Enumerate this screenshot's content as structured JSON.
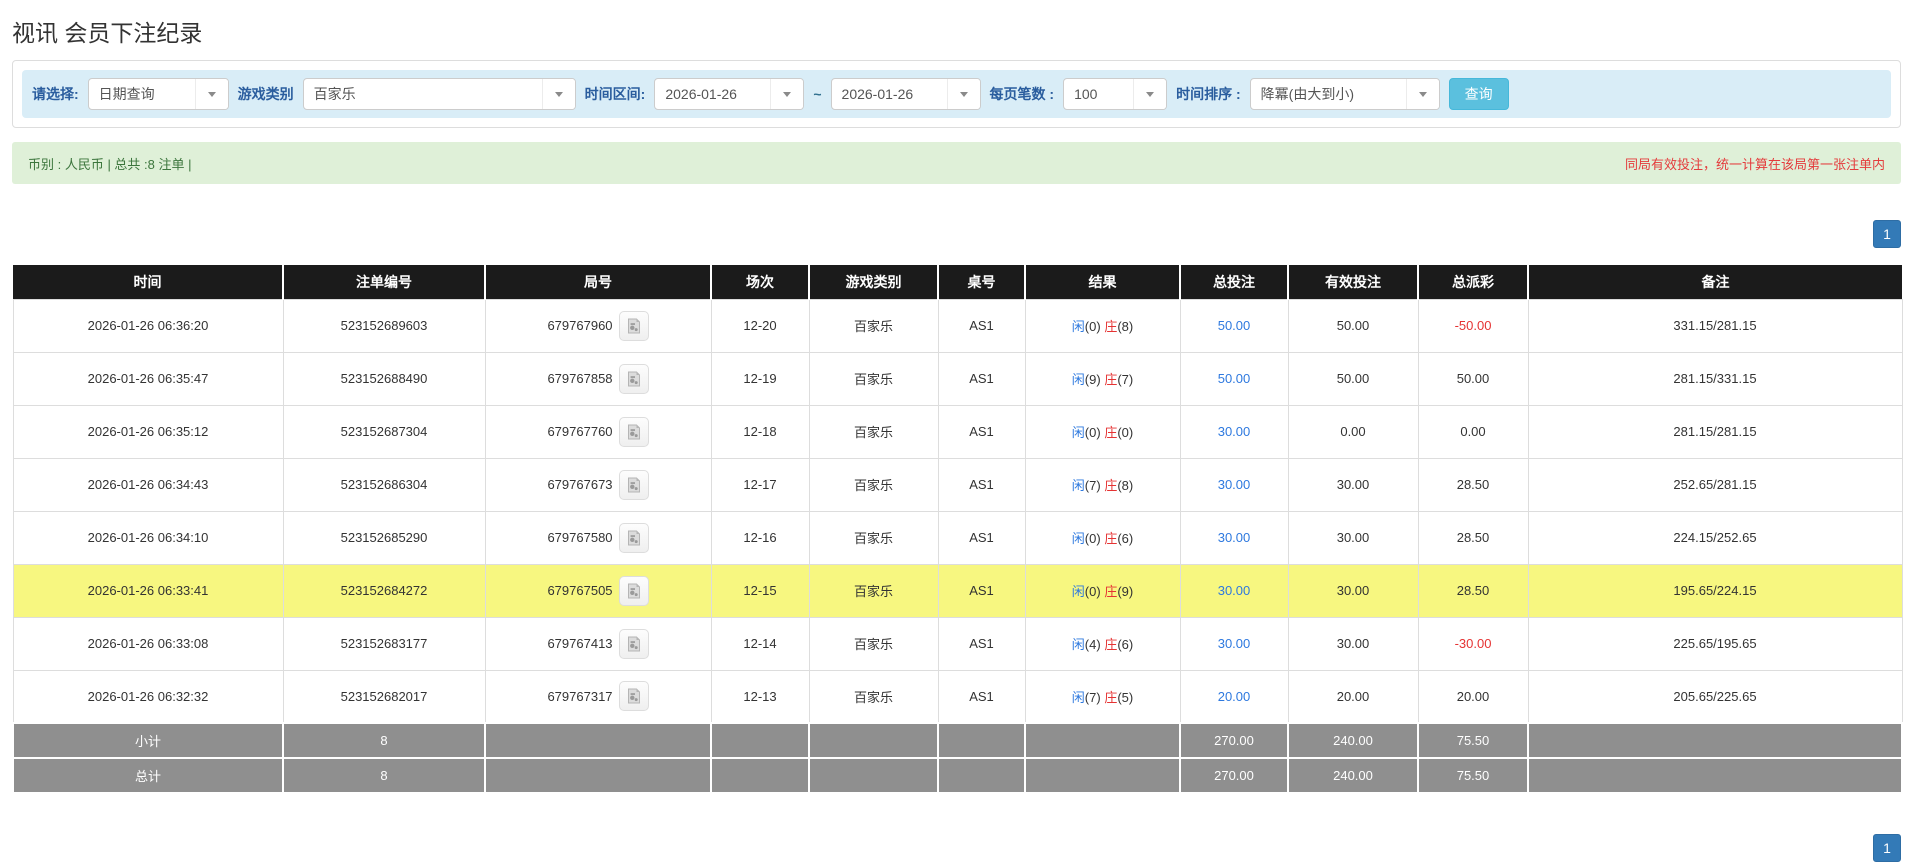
{
  "title": "视讯 会员下注纪录",
  "filter": {
    "select_label": "请选择:",
    "select_value": "日期查询",
    "game_type_label": "游戏类别",
    "game_type_value": "百家乐",
    "time_range_label": "时间区间:",
    "date_from": "2026-01-26",
    "date_separator": "~",
    "date_to": "2026-01-26",
    "page_size_label": "每页笔数 :",
    "page_size_value": "100",
    "sort_label": "时间排序 :",
    "sort_value": "降冪(由大到小)",
    "query_button": "查询"
  },
  "summary_bar": {
    "left_text": "币别 : 人民币 | 总共 :8 注单 |",
    "right_text": "同局有效投注，统一计算在该局第一张注单内"
  },
  "pagination": {
    "page": "1"
  },
  "table": {
    "headers": [
      "时间",
      "注单编号",
      "局号",
      "场次",
      "游戏类别",
      "桌号",
      "结果",
      "总投注",
      "有效投注",
      "总派彩",
      "备注"
    ],
    "result_labels": {
      "player": "闲",
      "banker": "庄"
    },
    "rows": [
      {
        "time": "2026-01-26 06:36:20",
        "bet_no": "523152689603",
        "round_no": "679767960",
        "session": "12-20",
        "game": "百家乐",
        "table_no": "AS1",
        "player": "0",
        "banker": "8",
        "total_bet": "50.00",
        "valid_bet": "50.00",
        "payout": "-50.00",
        "payout_negative": true,
        "remark": "331.15/281.15",
        "highlighted": false
      },
      {
        "time": "2026-01-26 06:35:47",
        "bet_no": "523152688490",
        "round_no": "679767858",
        "session": "12-19",
        "game": "百家乐",
        "table_no": "AS1",
        "player": "9",
        "banker": "7",
        "total_bet": "50.00",
        "valid_bet": "50.00",
        "payout": "50.00",
        "payout_negative": false,
        "remark": "281.15/331.15",
        "highlighted": false
      },
      {
        "time": "2026-01-26 06:35:12",
        "bet_no": "523152687304",
        "round_no": "679767760",
        "session": "12-18",
        "game": "百家乐",
        "table_no": "AS1",
        "player": "0",
        "banker": "0",
        "total_bet": "30.00",
        "valid_bet": "0.00",
        "payout": "0.00",
        "payout_negative": false,
        "remark": "281.15/281.15",
        "highlighted": false
      },
      {
        "time": "2026-01-26 06:34:43",
        "bet_no": "523152686304",
        "round_no": "679767673",
        "session": "12-17",
        "game": "百家乐",
        "table_no": "AS1",
        "player": "7",
        "banker": "8",
        "total_bet": "30.00",
        "valid_bet": "30.00",
        "payout": "28.50",
        "payout_negative": false,
        "remark": "252.65/281.15",
        "highlighted": false
      },
      {
        "time": "2026-01-26 06:34:10",
        "bet_no": "523152685290",
        "round_no": "679767580",
        "session": "12-16",
        "game": "百家乐",
        "table_no": "AS1",
        "player": "0",
        "banker": "6",
        "total_bet": "30.00",
        "valid_bet": "30.00",
        "payout": "28.50",
        "payout_negative": false,
        "remark": "224.15/252.65",
        "highlighted": false
      },
      {
        "time": "2026-01-26 06:33:41",
        "bet_no": "523152684272",
        "round_no": "679767505",
        "session": "12-15",
        "game": "百家乐",
        "table_no": "AS1",
        "player": "0",
        "banker": "9",
        "total_bet": "30.00",
        "valid_bet": "30.00",
        "payout": "28.50",
        "payout_negative": false,
        "remark": "195.65/224.15",
        "highlighted": true
      },
      {
        "time": "2026-01-26 06:33:08",
        "bet_no": "523152683177",
        "round_no": "679767413",
        "session": "12-14",
        "game": "百家乐",
        "table_no": "AS1",
        "player": "4",
        "banker": "6",
        "total_bet": "30.00",
        "valid_bet": "30.00",
        "payout": "-30.00",
        "payout_negative": true,
        "remark": "225.65/195.65",
        "highlighted": false
      },
      {
        "time": "2026-01-26 06:32:32",
        "bet_no": "523152682017",
        "round_no": "679767317",
        "session": "12-13",
        "game": "百家乐",
        "table_no": "AS1",
        "player": "7",
        "banker": "5",
        "total_bet": "20.00",
        "valid_bet": "20.00",
        "payout": "20.00",
        "payout_negative": false,
        "remark": "205.65/225.65",
        "highlighted": false
      }
    ],
    "summary_rows": [
      {
        "label": "小计",
        "count": "8",
        "total_bet": "270.00",
        "valid_bet": "240.00",
        "payout": "75.50"
      },
      {
        "label": "总计",
        "count": "8",
        "total_bet": "270.00",
        "valid_bet": "240.00",
        "payout": "75.50"
      }
    ]
  },
  "colors": {
    "header_bg": "#1b1b1b",
    "highlight_row": "#f7f780",
    "summary_bg": "#8f8f8f",
    "link_blue": "#2e79df",
    "player_blue": "#2e79df",
    "negative_red": "#e53333",
    "banker_red": "#e53333",
    "query_button_bg": "#5bc0de",
    "pagination_bg": "#337ab7",
    "filter_bar_bg": "#d9edf7",
    "notice_bg": "#dff0d8",
    "notice_text": "#3c763d",
    "notice_warning_text": "#e43b3c",
    "filter_label": "#2a5d9e"
  }
}
